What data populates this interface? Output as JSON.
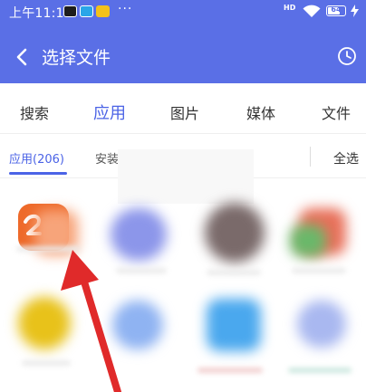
{
  "status_bar": {
    "time": "上午11:14",
    "dots": "···",
    "network": "HD",
    "battery": "64",
    "battery_level": 0.64
  },
  "header": {
    "back_icon": "chevron-left-icon",
    "title": "选择文件",
    "history_icon": "clock-icon"
  },
  "tabs": [
    {
      "label": "搜索",
      "active": false
    },
    {
      "label": "应用",
      "active": true
    },
    {
      "label": "图片",
      "active": false
    },
    {
      "label": "媒体",
      "active": false
    },
    {
      "label": "文件",
      "active": false
    }
  ],
  "subtabs": {
    "active": "应用(206)",
    "second": "安装",
    "select_all": "全选"
  },
  "colors": {
    "header_bg": "#5a6fe6",
    "accent": "#4b63e6",
    "arrow": "#e02a2a"
  }
}
